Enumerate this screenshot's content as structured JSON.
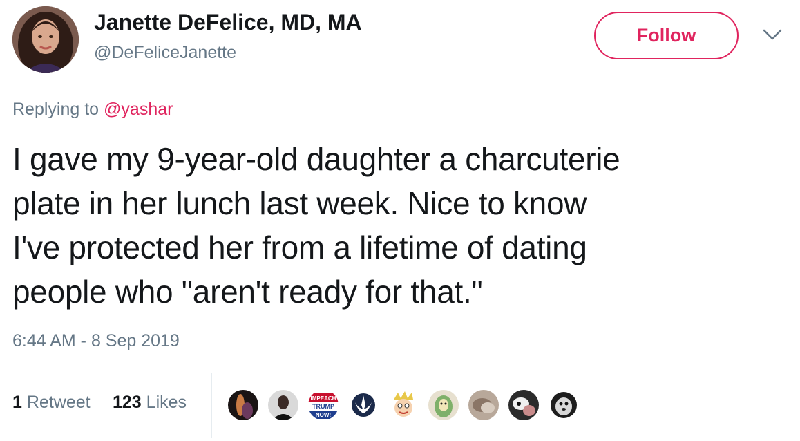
{
  "author": {
    "display_name": "Janette DeFelice, MD, MA",
    "handle": "@DeFeliceJanette",
    "avatar_icon": "profile-photo-icon"
  },
  "actions": {
    "follow_label": "Follow",
    "more_icon": "chevron-down-icon"
  },
  "reply": {
    "prefix": "Replying to",
    "mention": "@yashar"
  },
  "tweet": {
    "lines": [
      "I gave my 9-year-old daughter a charcuterie",
      "plate in her lunch last week. Nice to know",
      "I've protected her from a lifetime of dating",
      "people who \"aren't ready for that.\""
    ],
    "timestamp": "6:44 AM - 8 Sep 2019"
  },
  "stats": {
    "retweet_count": "1",
    "retweet_label": "Retweet",
    "like_count": "123",
    "like_label": "Likes"
  },
  "likers": [
    {
      "icon": "liker-avatar-icon"
    },
    {
      "icon": "liker-avatar-icon"
    },
    {
      "icon": "impeach-trump-badge-icon",
      "text_top": "IMPEACH",
      "text_mid": "TRUMP",
      "text_bot": "NOW!"
    },
    {
      "icon": "rebel-alliance-icon"
    },
    {
      "icon": "cartoon-face-icon"
    },
    {
      "icon": "green-drawing-icon"
    },
    {
      "icon": "liker-avatar-icon"
    },
    {
      "icon": "liker-avatar-icon"
    },
    {
      "icon": "dog-avatar-icon"
    }
  ],
  "colors": {
    "accent": "#e0245e",
    "muted": "#657786",
    "text": "#14171a",
    "divider": "#e6ecf0"
  }
}
